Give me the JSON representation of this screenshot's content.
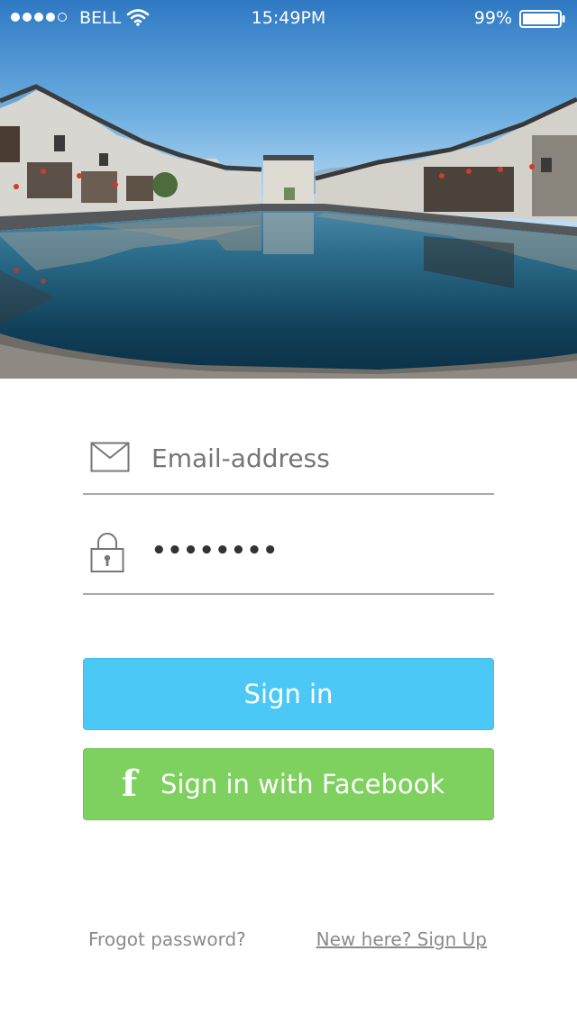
{
  "status_bar": {
    "carrier": "BELL",
    "time": "15:49PM",
    "battery": "99%",
    "signal_strength": 4,
    "signal_icon": "signal-dots-icon",
    "wifi_icon": "wifi-icon",
    "battery_icon": "battery-icon"
  },
  "hero": {
    "image": "village-waterfront-reflection-photo"
  },
  "form": {
    "email": {
      "placeholder": "Email-address",
      "value": "",
      "icon": "envelope-icon"
    },
    "password": {
      "value": "••••••••",
      "icon": "lock-icon"
    }
  },
  "buttons": {
    "signin_label": "Sign in",
    "facebook_label": "Sign in with Facebook",
    "facebook_icon": "facebook-icon",
    "facebook_glyph": "f"
  },
  "links": {
    "forgot": "Frogot password?",
    "signup": "New here? Sign Up"
  },
  "colors": {
    "signin": "#4cc8f6",
    "facebook": "#7ed05f",
    "divider": "#a9a9a9",
    "link": "#8a8a8a"
  }
}
